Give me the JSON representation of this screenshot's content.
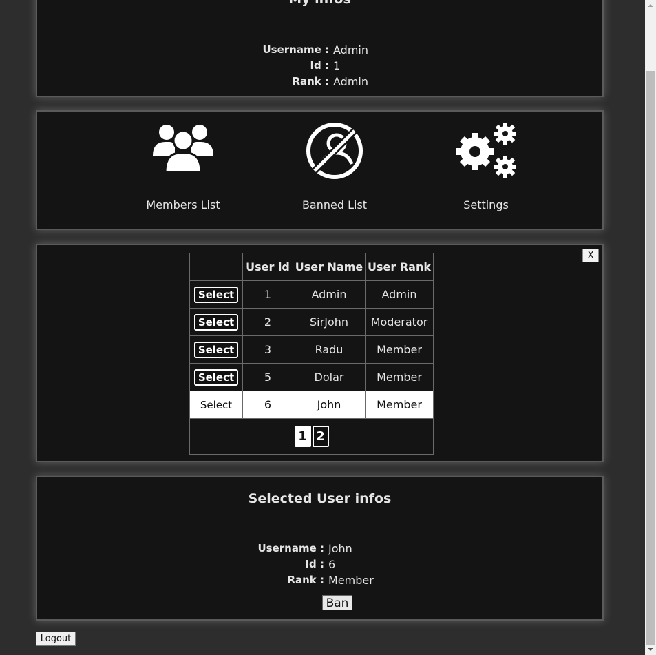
{
  "my_infos": {
    "title": "My infos",
    "username_label": "Username :",
    "username_value": "Admin",
    "id_label": "Id :",
    "id_value": "1",
    "rank_label": "Rank :",
    "rank_value": "Admin"
  },
  "menu": {
    "items": [
      {
        "label": "Members List",
        "icon": "users-icon"
      },
      {
        "label": "Banned List",
        "icon": "banned-user-icon"
      },
      {
        "label": "Settings",
        "icon": "gears-icon"
      }
    ]
  },
  "members": {
    "close_label": "X",
    "columns": [
      "",
      "User id",
      "User Name",
      "User Rank"
    ],
    "select_label": "Select",
    "rows": [
      {
        "id": "1",
        "name": "Admin",
        "rank": "Admin"
      },
      {
        "id": "2",
        "name": "SirJohn",
        "rank": "Moderator"
      },
      {
        "id": "3",
        "name": "Radu",
        "rank": "Member"
      },
      {
        "id": "5",
        "name": "Dolar",
        "rank": "Member"
      },
      {
        "id": "6",
        "name": "John",
        "rank": "Member"
      }
    ],
    "selected_row_index": 4,
    "pages": [
      "1",
      "2"
    ],
    "current_page": "1"
  },
  "selected_user": {
    "title": "Selected User infos",
    "username_label": "Username :",
    "username_value": "John",
    "id_label": "Id :",
    "id_value": "6",
    "rank_label": "Rank :",
    "rank_value": "Member",
    "ban_label": "Ban"
  },
  "logout_label": "Logout"
}
